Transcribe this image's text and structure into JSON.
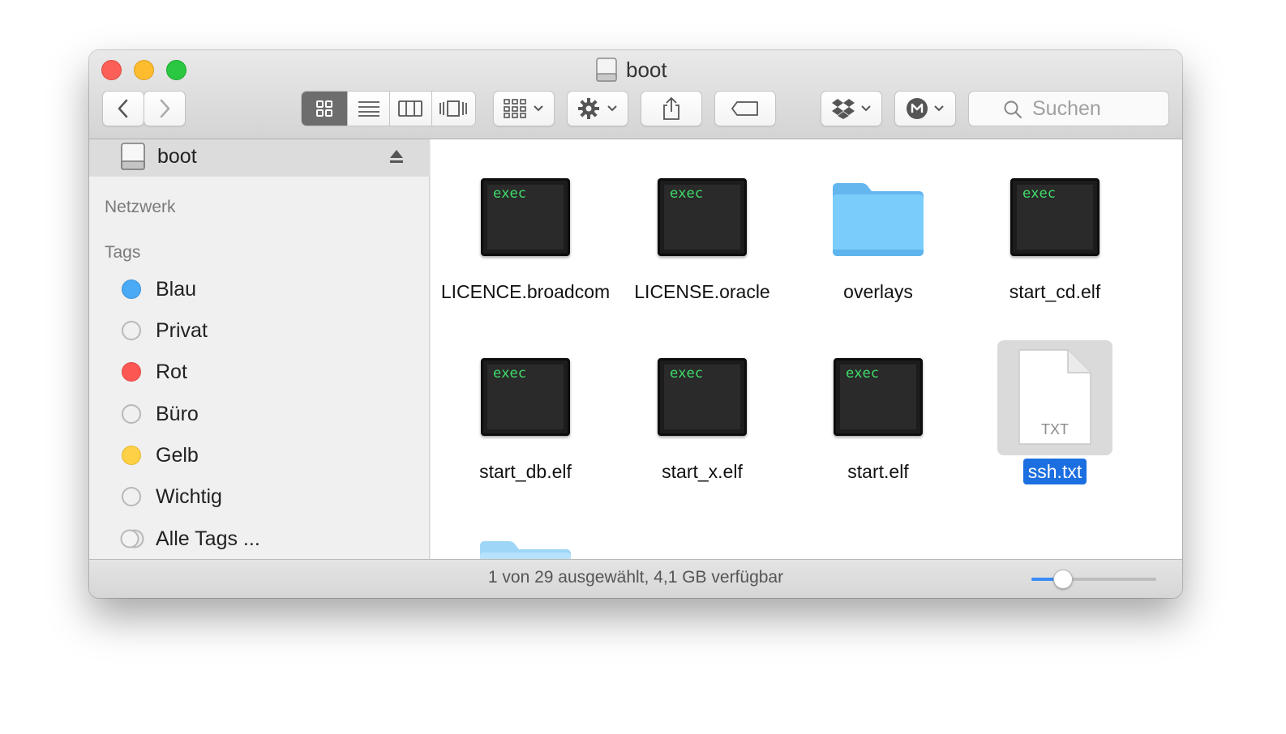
{
  "window": {
    "title": "boot"
  },
  "toolbar": {
    "search_placeholder": "Suchen",
    "icons": {
      "back": "chevron-left-icon",
      "forward": "chevron-right-icon",
      "view_icons": "grid-view-icon",
      "view_list": "list-view-icon",
      "view_columns": "column-view-icon",
      "view_coverflow": "coverflow-view-icon",
      "arrange": "arrange-icon",
      "action": "gear-icon",
      "share": "share-icon",
      "tags": "tag-icon",
      "dropbox": "dropbox-icon",
      "mega": "mega-icon",
      "search": "search-icon"
    }
  },
  "sidebar": {
    "device": {
      "label": "boot"
    },
    "network_heading": "Netzwerk",
    "tags_heading": "Tags",
    "tags": [
      {
        "label": "Blau",
        "color": "#4aaaf5",
        "empty": false
      },
      {
        "label": "Privat",
        "color": "",
        "empty": true
      },
      {
        "label": "Rot",
        "color": "#fc5753",
        "empty": false
      },
      {
        "label": "Büro",
        "color": "",
        "empty": true
      },
      {
        "label": "Gelb",
        "color": "#fdd045",
        "empty": false
      },
      {
        "label": "Wichtig",
        "color": "",
        "empty": true
      },
      {
        "label": "Alle Tags ...",
        "color": "",
        "empty": true
      }
    ]
  },
  "files": [
    {
      "name": "LICENCE.broadcom",
      "type": "exec",
      "badge": "exec"
    },
    {
      "name": "LICENSE.oracle",
      "type": "exec",
      "badge": "exec"
    },
    {
      "name": "overlays",
      "type": "folder"
    },
    {
      "name": "start_cd.elf",
      "type": "exec",
      "badge": "exec"
    },
    {
      "name": "start_db.elf",
      "type": "exec",
      "badge": "exec"
    },
    {
      "name": "start_x.elf",
      "type": "exec",
      "badge": "exec"
    },
    {
      "name": "start.elf",
      "type": "exec",
      "badge": "exec"
    },
    {
      "name": "ssh.txt",
      "type": "txt",
      "badge": "TXT",
      "selected": true
    }
  ],
  "status": {
    "text": "1 von 29 ausgewählt, 4,1 GB verfügbar",
    "icon_size_fraction": 0.25
  },
  "colors": {
    "selection": "#1c6fe0",
    "folder": "#6fc4f8",
    "exec_text": "#3fdd6b"
  }
}
